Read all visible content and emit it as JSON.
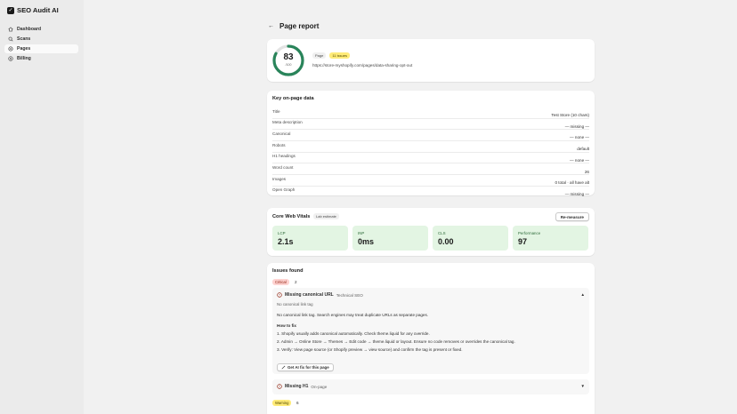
{
  "app": {
    "name": "SEO Audit AI"
  },
  "sidebar": {
    "items": [
      {
        "label": "Dashboard",
        "icon": "home-icon"
      },
      {
        "label": "Scans",
        "icon": "search-icon"
      },
      {
        "label": "Pages",
        "icon": "gear-icon",
        "active": true
      },
      {
        "label": "Billing",
        "icon": "dollar-icon"
      }
    ]
  },
  "page": {
    "title": "Page report",
    "back_icon": "arrow-left-icon"
  },
  "score": {
    "value": "83",
    "max": "/100",
    "fraction": 0.83,
    "type_label": "Page",
    "issues_label": "11 issues",
    "url": "https://store-myshopify.com/pages/data-sharing-opt-out"
  },
  "onpage": {
    "title": "Key on-page data",
    "rows": [
      {
        "key": "Title",
        "value": "Test Store (10 chars)"
      },
      {
        "key": "Meta description",
        "value": "— missing —"
      },
      {
        "key": "Canonical",
        "value": "— none —"
      },
      {
        "key": "Robots",
        "value": "default"
      },
      {
        "key": "H1 headings",
        "value": "— none —"
      },
      {
        "key": "Word count",
        "value": "26"
      },
      {
        "key": "Images",
        "value": "0 total · all have alt"
      },
      {
        "key": "Open Graph",
        "value": "— missing —"
      }
    ]
  },
  "vitals": {
    "title": "Core Web Vitals",
    "badge": "Lab estimate",
    "remeasure_label": "Re-measure",
    "metrics": [
      {
        "label": "LCP",
        "value": "2.1s"
      },
      {
        "label": "INP",
        "value": "0ms"
      },
      {
        "label": "CLS",
        "value": "0.00"
      },
      {
        "label": "Performance",
        "value": "97"
      }
    ],
    "good_color": "#e3f5e3"
  },
  "issues": {
    "title": "Issues found",
    "critical": {
      "label": "Critical",
      "count": "2"
    },
    "warning": {
      "label": "Warning",
      "count": "6"
    },
    "items": [
      {
        "name": "Missing canonical URL",
        "category": "Technical SEO",
        "caret": "▲",
        "short": "No canonical link tag",
        "description": "No canonical link tag. Search engines may treat duplicate URLs as separate pages.",
        "how_to_fix_label": "How to fix",
        "steps": [
          "1. Shopify usually adds canonical automatically. Check theme.liquid for any override.",
          "2. Admin → Online Store → Themes → Edit code → theme.liquid or layout. Ensure no code removes or overrides the canonical tag.",
          "3. Verify: View page source (or Shopify preview → view source) and confirm the tag is present or fixed."
        ],
        "ai_fix_label": "Get AI fix for this page"
      },
      {
        "name": "Missing H1",
        "category": "On-page",
        "caret": "▼"
      }
    ]
  },
  "colors": {
    "score_ring": "#29845a",
    "critical_bg": "#fed3d1",
    "warning_bg": "#ffeb78",
    "sidebar_bg": "#ebebeb",
    "page_bg": "#f1f1f1"
  }
}
